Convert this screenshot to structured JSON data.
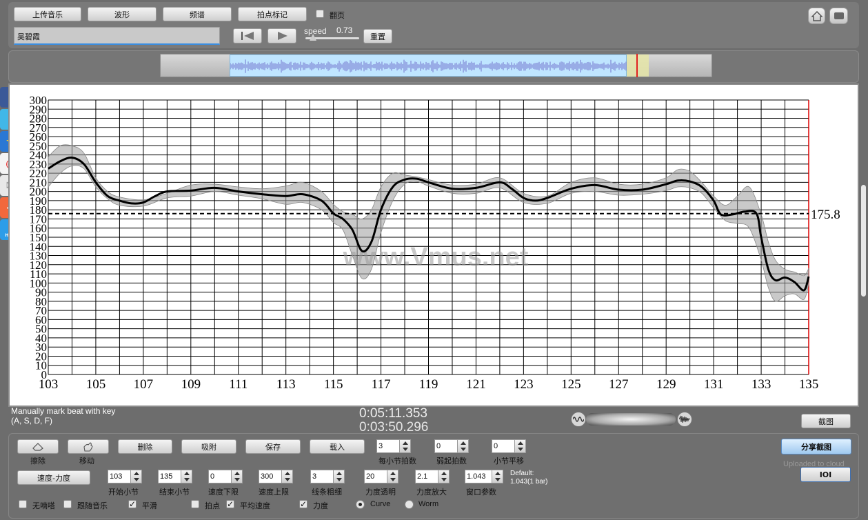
{
  "toolbar": {
    "upload_label": "上传音乐",
    "waveform_label": "波形",
    "spectrum_label": "频谱",
    "beat_mark_label": "拍点标记",
    "page_turn_label": "翻页",
    "song_title": "吴碧霞",
    "speed_label": "speed",
    "speed_value": "0.73",
    "reset_label": "重置"
  },
  "chart_data": {
    "type": "line",
    "x_ticks": [
      "103",
      "105",
      "107",
      "109",
      "111",
      "113",
      "115",
      "117",
      "119",
      "121",
      "123",
      "125",
      "127",
      "129",
      "131",
      "133",
      "135"
    ],
    "y_ticks": [
      "0",
      "10",
      "20",
      "30",
      "40",
      "50",
      "60",
      "70",
      "80",
      "90",
      "100",
      "110",
      "120",
      "130",
      "140",
      "150",
      "160",
      "170",
      "180",
      "190",
      "200",
      "210",
      "220",
      "230",
      "240",
      "250",
      "260",
      "270",
      "280",
      "290",
      "300"
    ],
    "xlim": [
      103,
      135
    ],
    "ylim": [
      0,
      300
    ],
    "average_line_value": 175.8,
    "average_label": "175.8",
    "watermark": "www.Vmus.net",
    "series": [
      {
        "x": [
          103,
          103.5,
          104,
          104.5,
          105,
          105.5,
          106,
          106.5,
          107,
          107.5,
          108,
          109,
          110,
          111,
          112,
          113,
          113.7,
          114.5,
          115,
          115.4,
          115.8,
          116.2,
          116.6,
          117,
          117.5,
          118,
          118.5,
          119,
          120,
          121,
          122,
          122.5,
          123,
          123.5,
          124,
          125,
          126,
          127,
          128,
          129,
          129.5,
          130,
          130.5,
          131,
          131.3,
          131.8,
          132.3,
          132.8,
          133,
          133.3,
          133.6,
          134,
          134.4,
          134.8,
          135
        ],
        "y": [
          225,
          233,
          237,
          230,
          210,
          195,
          190,
          187,
          188,
          195,
          200,
          201,
          204,
          200,
          197,
          195,
          197,
          190,
          176,
          170,
          158,
          135,
          145,
          180,
          205,
          213,
          214,
          210,
          203,
          204,
          210,
          203,
          193,
          190,
          193,
          203,
          207,
          202,
          202,
          208,
          212,
          211,
          205,
          190,
          175,
          175,
          178,
          176,
          150,
          115,
          103,
          106,
          101,
          92,
          107
        ]
      },
      {
        "x": [
          103,
          103.5,
          104,
          104.5,
          105,
          105.5,
          106,
          107,
          108,
          109,
          110,
          111,
          112,
          113,
          113.7,
          114.5,
          115,
          115.4,
          115.8,
          116.2,
          116.6,
          117,
          117.5,
          118,
          118.5,
          119,
          120,
          121,
          122,
          123,
          124,
          125,
          126,
          127,
          128,
          129,
          129.5,
          130,
          130.5,
          131,
          131.5,
          132,
          132.5,
          133,
          133.3,
          133.6,
          134,
          134.4,
          134.8,
          135
        ],
        "y": [
          238,
          250,
          250,
          242,
          215,
          200,
          194,
          191,
          198,
          207,
          208,
          205,
          203,
          206,
          210,
          200,
          186,
          178,
          175,
          170,
          180,
          205,
          220,
          218,
          216,
          213,
          207,
          208,
          215,
          198,
          195,
          210,
          215,
          208,
          208,
          215,
          224,
          222,
          210,
          195,
          185,
          195,
          205,
          175,
          145,
          125,
          115,
          112,
          108,
          116
        ]
      },
      {
        "x": [
          103,
          103.5,
          104,
          104.5,
          105,
          105.5,
          106,
          107,
          108,
          109,
          110,
          111,
          112,
          113,
          113.7,
          114.5,
          115,
          115.4,
          115.8,
          116.2,
          116.6,
          117,
          117.5,
          118,
          118.5,
          119,
          120,
          121,
          122,
          123,
          124,
          125,
          126,
          127,
          128,
          129,
          129.5,
          130,
          130.5,
          131,
          131.5,
          132,
          132.5,
          133,
          133.3,
          133.6,
          134,
          134.4,
          134.8,
          135
        ],
        "y": [
          205,
          220,
          228,
          225,
          205,
          192,
          185,
          184,
          193,
          195,
          200,
          196,
          192,
          186,
          188,
          180,
          166,
          158,
          130,
          105,
          115,
          155,
          190,
          208,
          211,
          206,
          198,
          198,
          204,
          188,
          187,
          198,
          200,
          196,
          197,
          201,
          205,
          204,
          198,
          182,
          168,
          165,
          160,
          125,
          95,
          80,
          86,
          88,
          82,
          98
        ]
      }
    ]
  },
  "status": {
    "hint_line1": "Manually mark beat with key",
    "hint_line2": "(A, S, D, F)",
    "time_current": "0:05:11.353",
    "time_total": "0:03:50.296",
    "screenshot_label": "截图"
  },
  "controls": {
    "erase_label": "擦除",
    "move_label": "移动",
    "delete_label": "删除",
    "snap_label": "吸附",
    "save_label": "保存",
    "load_label": "载入",
    "beats_per_bar_value": "3",
    "beats_per_bar_label": "每小节拍数",
    "upbeat_value": "0",
    "upbeat_label": "弱起拍数",
    "bar_shift_value": "0",
    "bar_shift_label": "小节平移",
    "share_screenshot_label": "分享截图",
    "uploaded_label": "Uploaded to cloud",
    "tempo_force_label": "速度-力度",
    "start_bar_value": "103",
    "start_bar_label": "开始小节",
    "end_bar_value": "135",
    "end_bar_label": "结束小节",
    "tempo_min_value": "0",
    "tempo_min_label": "速度下限",
    "tempo_max_value": "300",
    "tempo_max_label": "速度上限",
    "line_width_value": "3",
    "line_width_label": "线条粗细",
    "force_opacity_value": "20",
    "force_opacity_label": "力度透明",
    "force_scale_value": "2.1",
    "force_scale_label": "力度放大",
    "window_param_value": "1.043",
    "window_param_label": "窗口参数",
    "default_line1": "Default:",
    "default_line2": "1.043(1 bar)",
    "ioi_label": "IOI",
    "no_click_label": "无嘀嗒",
    "follow_music_label": "跟随音乐",
    "smooth_label": "平滑",
    "beat_points_label": "拍点",
    "avg_tempo_label": "平均速度",
    "force_label": "力度",
    "curve_label": "Curve",
    "worm_label": "Worm",
    "checked_mark": "✓"
  },
  "share": {
    "help_text": "HELP"
  }
}
